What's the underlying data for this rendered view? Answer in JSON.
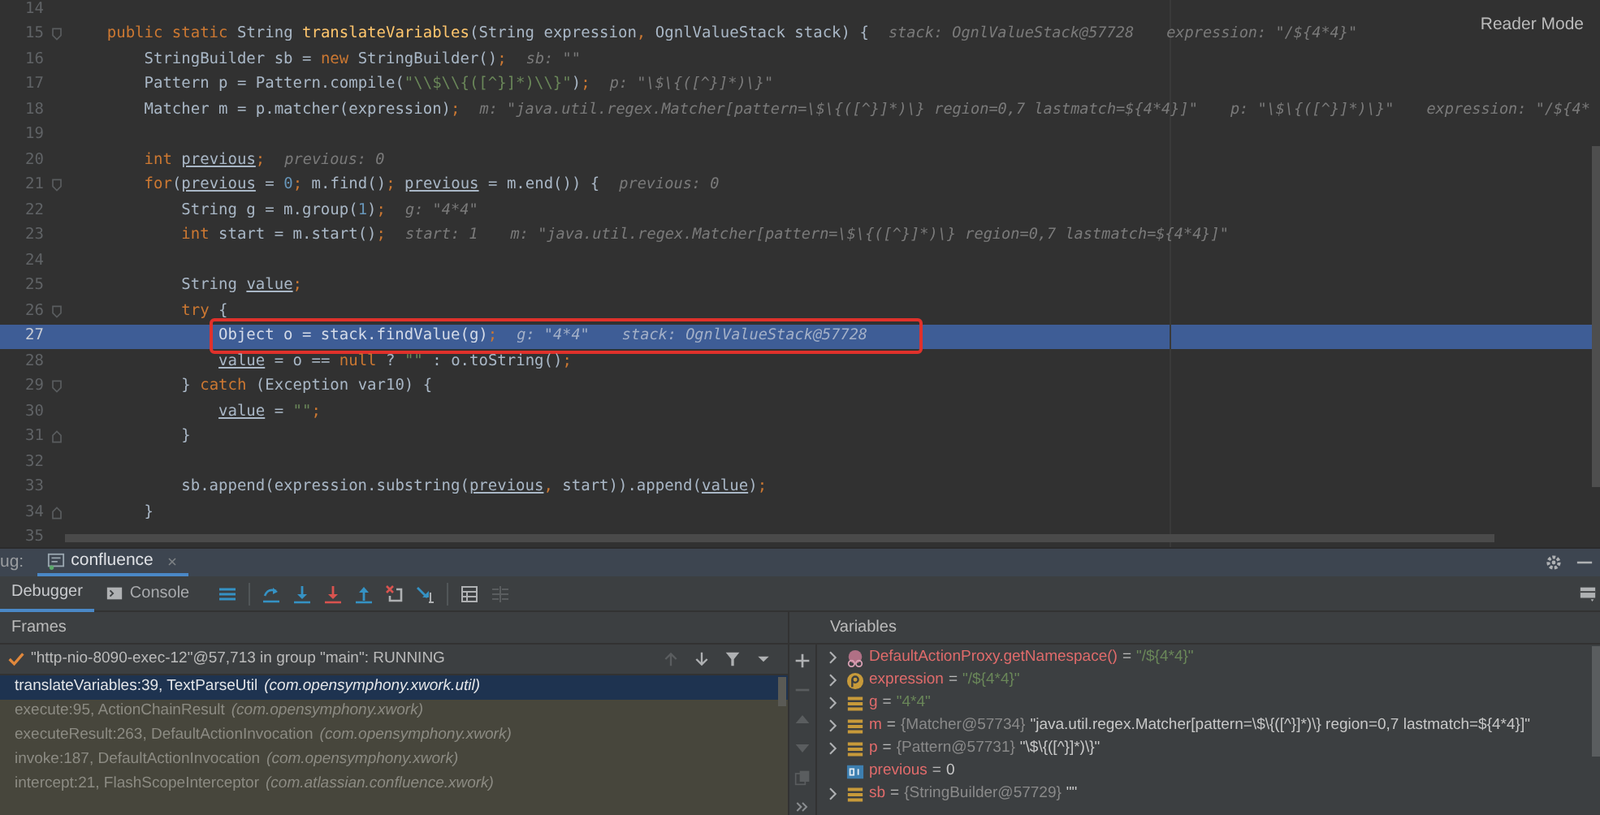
{
  "editor": {
    "reader_mode": "Reader Mode",
    "lines": [
      {
        "number": "14",
        "current": false,
        "boxed": false
      },
      {
        "number": "15",
        "fold_marker": {
          "kind": "start"
        },
        "current": false,
        "boxed": false,
        "tokens": [
          {
            "text": "    public static ",
            "kind": "keyword"
          },
          {
            "text": "String ",
            "kind": "plain"
          },
          {
            "text": "translateVariables",
            "kind": "function"
          },
          {
            "text": "(String expression",
            "kind": "plain"
          },
          {
            "text": ", ",
            "kind": "keyword"
          },
          {
            "text": "OgnlValueStack stack) {",
            "kind": "plain"
          }
        ],
        "hints": [
          "stack: OgnlValueStack@57728",
          "expression: \"/${4*4}\""
        ]
      },
      {
        "number": "16",
        "current": false,
        "boxed": false,
        "tokens": [
          {
            "text": "        StringBuilder sb = ",
            "kind": "plain"
          },
          {
            "text": "new ",
            "kind": "keyword"
          },
          {
            "text": "StringBuilder()",
            "kind": "plain"
          },
          {
            "text": ";",
            "kind": "keyword"
          }
        ],
        "hints": [
          "sb: \"\""
        ]
      },
      {
        "number": "17",
        "current": false,
        "boxed": false,
        "tokens": [
          {
            "text": "        Pattern p = Pattern.compile(",
            "kind": "plain"
          },
          {
            "text": "\"\\\\$\\\\{([^}]*)\\\\}\"",
            "kind": "string"
          },
          {
            "text": ")",
            "kind": "plain"
          },
          {
            "text": ";",
            "kind": "keyword"
          }
        ],
        "hints": [
          "p: \"\\$\\{([^}]*)\\}\""
        ]
      },
      {
        "number": "18",
        "current": false,
        "boxed": false,
        "tokens": [
          {
            "text": "        Matcher m = p.matcher(expression)",
            "kind": "plain"
          },
          {
            "text": ";",
            "kind": "keyword"
          }
        ],
        "hints": [
          "m: \"java.util.regex.Matcher[pattern=\\$\\{([^}]*)\\} region=0,7 lastmatch=${4*4}]\"",
          "p: \"\\$\\{([^}]*)\\}\"",
          "expression: \"/${4*"
        ]
      },
      {
        "number": "19",
        "current": false,
        "boxed": false
      },
      {
        "number": "20",
        "current": false,
        "boxed": false,
        "tokens": [
          {
            "text": "        int ",
            "kind": "keyword"
          },
          {
            "text": "previous",
            "kind": "variable"
          },
          {
            "text": ";",
            "kind": "keyword"
          }
        ],
        "hints": [
          "previous: 0"
        ]
      },
      {
        "number": "21",
        "fold_marker": {
          "kind": "start"
        },
        "current": false,
        "boxed": false,
        "tokens": [
          {
            "text": "        for",
            "kind": "keyword"
          },
          {
            "text": "(",
            "kind": "plain"
          },
          {
            "text": "previous",
            "kind": "variable"
          },
          {
            "text": " = ",
            "kind": "plain"
          },
          {
            "text": "0",
            "kind": "number"
          },
          {
            "text": "; ",
            "kind": "keyword"
          },
          {
            "text": "m.find()",
            "kind": "plain"
          },
          {
            "text": "; ",
            "kind": "keyword"
          },
          {
            "text": "previous",
            "kind": "variable"
          },
          {
            "text": " = m.end()) {",
            "kind": "plain"
          }
        ],
        "hints": [
          "previous: 0"
        ]
      },
      {
        "number": "22",
        "current": false,
        "boxed": false,
        "tokens": [
          {
            "text": "            String g = m.group(",
            "kind": "plain"
          },
          {
            "text": "1",
            "kind": "number"
          },
          {
            "text": ")",
            "kind": "plain"
          },
          {
            "text": ";",
            "kind": "keyword"
          }
        ],
        "hints": [
          "g: \"4*4\""
        ]
      },
      {
        "number": "23",
        "current": false,
        "boxed": false,
        "tokens": [
          {
            "text": "            int ",
            "kind": "keyword"
          },
          {
            "text": "start = m.start()",
            "kind": "plain"
          },
          {
            "text": ";",
            "kind": "keyword"
          }
        ],
        "hints": [
          "start: 1",
          "m: \"java.util.regex.Matcher[pattern=\\$\\{([^}]*)\\} region=0,7 lastmatch=${4*4}]\""
        ]
      },
      {
        "number": "24",
        "current": false,
        "boxed": false
      },
      {
        "number": "25",
        "current": false,
        "boxed": false,
        "tokens": [
          {
            "text": "            String ",
            "kind": "plain"
          },
          {
            "text": "value",
            "kind": "variable"
          },
          {
            "text": ";",
            "kind": "keyword"
          }
        ]
      },
      {
        "number": "26",
        "fold_marker": {
          "kind": "start"
        },
        "current": false,
        "boxed": false,
        "tokens": [
          {
            "text": "            try ",
            "kind": "keyword"
          },
          {
            "text": "{",
            "kind": "plain"
          }
        ]
      },
      {
        "number": "27",
        "current": true,
        "boxed": true,
        "tokens": [
          {
            "text": "                Object o = stack.findValue(g)",
            "kind": "plain"
          },
          {
            "text": ";",
            "kind": "keyword"
          }
        ],
        "hints": [
          "g: \"4*4\"",
          "stack: OgnlValueStack@57728"
        ]
      },
      {
        "number": "28",
        "current": false,
        "boxed": false,
        "tokens": [
          {
            "text": "                value",
            "kind": "variable"
          },
          {
            "text": " = o == ",
            "kind": "plain"
          },
          {
            "text": "null ",
            "kind": "keyword"
          },
          {
            "text": "? ",
            "kind": "plain"
          },
          {
            "text": "\"\"",
            "kind": "string"
          },
          {
            "text": " : o.toString()",
            "kind": "plain"
          },
          {
            "text": ";",
            "kind": "keyword"
          }
        ]
      },
      {
        "number": "29",
        "fold_marker": {
          "kind": "start"
        },
        "current": false,
        "boxed": false,
        "tokens": [
          {
            "text": "            } ",
            "kind": "plain"
          },
          {
            "text": "catch ",
            "kind": "keyword"
          },
          {
            "text": "(Exception var10) {",
            "kind": "plain"
          }
        ]
      },
      {
        "number": "30",
        "current": false,
        "boxed": false,
        "tokens": [
          {
            "text": "                value",
            "kind": "variable"
          },
          {
            "text": " = ",
            "kind": "plain"
          },
          {
            "text": "\"\"",
            "kind": "string"
          },
          {
            "text": ";",
            "kind": "keyword"
          }
        ]
      },
      {
        "number": "31",
        "fold_marker": {
          "kind": "end"
        },
        "current": false,
        "boxed": false,
        "tokens": [
          {
            "text": "            }",
            "kind": "plain"
          }
        ]
      },
      {
        "number": "32",
        "current": false,
        "boxed": false
      },
      {
        "number": "33",
        "current": false,
        "boxed": false,
        "tokens": [
          {
            "text": "            sb.append(expression.substring(",
            "kind": "plain"
          },
          {
            "text": "previous",
            "kind": "variable"
          },
          {
            "text": ", ",
            "kind": "keyword"
          },
          {
            "text": "start)).append(",
            "kind": "plain"
          },
          {
            "text": "value",
            "kind": "variable"
          },
          {
            "text": ")",
            "kind": "plain"
          },
          {
            "text": ";",
            "kind": "keyword"
          }
        ]
      },
      {
        "number": "34",
        "fold_marker": {
          "kind": "end"
        },
        "current": false,
        "boxed": false,
        "tokens": [
          {
            "text": "        }",
            "kind": "plain"
          }
        ]
      },
      {
        "number": "35",
        "current": false,
        "boxed": false
      }
    ]
  },
  "debug": {
    "label": "ug:",
    "tabs": [
      {
        "label": "confluence",
        "selected": true
      }
    ],
    "views": [
      {
        "label": "Debugger",
        "selected": true
      },
      {
        "label": "Console",
        "selected": false
      }
    ],
    "frames": {
      "title": "Frames",
      "thread": "\"http-nio-8090-exec-12\"@57,713 in group \"main\": RUNNING",
      "items": [
        {
          "location": "translateVariables:39, TextParseUtil",
          "package": "(com.opensymphony.xwork.util)",
          "selected": true,
          "library": false
        },
        {
          "location": "execute:95, ActionChainResult",
          "package": "(com.opensymphony.xwork)",
          "selected": false,
          "library": true
        },
        {
          "location": "executeResult:263, DefaultActionInvocation",
          "package": "(com.opensymphony.xwork)",
          "selected": false,
          "library": true
        },
        {
          "location": "invoke:187, DefaultActionInvocation",
          "package": "(com.opensymphony.xwork)",
          "selected": false,
          "library": true
        },
        {
          "location": "intercept:21, FlashScopeInterceptor",
          "package": "(com.atlassian.confluence.xwork)",
          "selected": false,
          "library": true
        }
      ]
    },
    "variables": {
      "title": "Variables",
      "items": [
        {
          "kind": "watch",
          "expandable": true,
          "name": "DefaultActionProxy.getNamespace()",
          "sign": "=",
          "value": {
            "text": "\"/${4*4}\"",
            "kind": "string"
          }
        },
        {
          "kind": "param",
          "expandable": true,
          "name": "expression",
          "sign": "=",
          "value": {
            "text": "\"/${4*4}\"",
            "kind": "string"
          }
        },
        {
          "kind": "local",
          "expandable": true,
          "name": "g",
          "sign": "=",
          "value": {
            "text": "\"4*4\"",
            "kind": "string"
          }
        },
        {
          "kind": "local",
          "expandable": true,
          "name": "m",
          "sign": "=",
          "type": "{Matcher@57734}",
          "value": {
            "text": "\"java.util.regex.Matcher[pattern=\\$\\{([^}]*)\\} region=0,7 lastmatch=${4*4}]\"",
            "kind": "object"
          }
        },
        {
          "kind": "local",
          "expandable": true,
          "name": "p",
          "sign": "=",
          "type": "{Pattern@57731}",
          "value": {
            "text": "\"\\$\\{([^}]*)\\}\"",
            "kind": "object"
          }
        },
        {
          "kind": "primitive",
          "expandable": false,
          "name": "previous",
          "sign": "=",
          "value": {
            "text": "0",
            "kind": "object"
          }
        },
        {
          "kind": "local",
          "expandable": true,
          "name": "sb",
          "sign": "=",
          "type": "{StringBuilder@57729}",
          "value": {
            "text": "\"\"",
            "kind": "object"
          }
        }
      ]
    }
  }
}
